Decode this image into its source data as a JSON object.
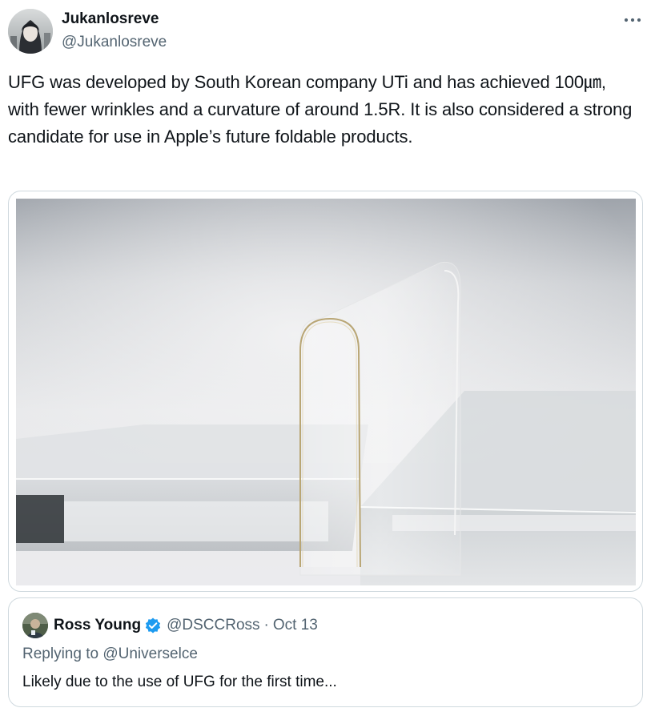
{
  "author": {
    "display_name": "Jukanlosreve",
    "handle": "@Jukanlosreve"
  },
  "menu": {
    "more_icon": "more-horizontal-icon"
  },
  "tweet": {
    "text": "UFG was developed by South Korean company UTi and has achieved 100㎛, with fewer wrinkles and a curvature of around 1.5R. It is also considered a strong candidate for use in Apple’s future foldable products."
  },
  "media": {
    "type": "photo",
    "description_icon": "photo-glass-fold-icon"
  },
  "quote": {
    "display_name": "Ross Young",
    "verified_icon": "verified-badge-icon",
    "handle": "@DSCCRoss",
    "separator": "·",
    "date": "Oct 13",
    "replying_prefix": "Replying to",
    "replying_handle": "@Universelce",
    "text": "Likely due to the use of UFG for the first time..."
  },
  "colors": {
    "text_primary": "#0f1419",
    "text_secondary": "#536471",
    "border": "#cfd9de",
    "verified": "#1d9bf0"
  }
}
